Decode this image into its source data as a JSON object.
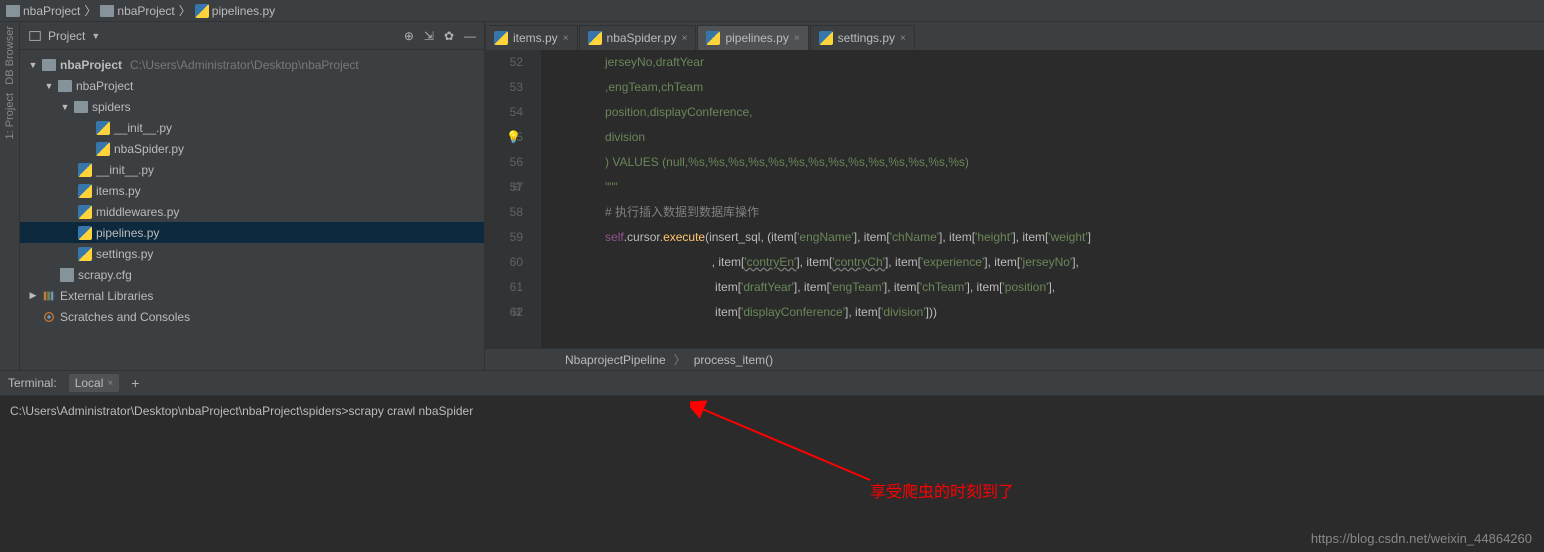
{
  "breadcrumb": {
    "root": "nbaProject",
    "folder": "nbaProject",
    "file": "pipelines.py"
  },
  "panel": {
    "title": "Project"
  },
  "tree": {
    "root": {
      "name": "nbaProject",
      "path": "C:\\Users\\Administrator\\Desktop\\nbaProject"
    },
    "pkg": "nbaProject",
    "spiders": "spiders",
    "init": "__init__.py",
    "nbaSpider": "nbaSpider.py",
    "init2": "__init__.py",
    "items": "items.py",
    "middlewares": "middlewares.py",
    "pipelines": "pipelines.py",
    "settings": "settings.py",
    "scrapycfg": "scrapy.cfg",
    "ext": "External Libraries",
    "scratches": "Scratches and Consoles"
  },
  "tabs": [
    {
      "label": "items.py"
    },
    {
      "label": "nbaSpider.py"
    },
    {
      "label": "pipelines.py"
    },
    {
      "label": "settings.py"
    }
  ],
  "code": {
    "lines": [
      "52",
      "53",
      "54",
      "55",
      "56",
      "57",
      "58",
      "59",
      "60",
      "61",
      "62"
    ],
    "l52a": "jerseyNo",
    "l52b": "draftYear",
    "l53a": "engTeam",
    "l53b": "chTeam",
    "l54a": "position",
    "l54b": "displayConference",
    "l55a": "division",
    "l56a": ") VALUES (null,%s,%s,%s,%s,%s,%s,%s,%s,%s,%s,%s,%s,%s,%s)",
    "l56b": "\"\"\"",
    "l58": "# 执行插入数据到数据库操作",
    "l59self": "self",
    "l59fn": "execute",
    "l59args": "(insert_sql, (item[",
    "l59f1": "'engName'",
    "l59f2": "'chName'",
    "l59f3": "'height'",
    "l59f4": "'weight'",
    "l60sep": ", item[",
    "l60a": "'contryEn'",
    "l60b": "'contryCh'",
    "l60c": "'experience'",
    "l60d": "'jerseyNo'",
    "l61a": "'draftYear'",
    "l61b": "'engTeam'",
    "l61c": "'chTeam'",
    "l61d": "'position'",
    "l62a": "'displayConference'",
    "l62b": "'division'"
  },
  "crumb2": {
    "cls": "NbaprojectPipeline",
    "fn": "process_item()"
  },
  "terminal": {
    "label": "Terminal:",
    "tab": "Local",
    "prompt": "C:\\Users\\Administrator\\Desktop\\nbaProject\\nbaProject\\spiders>",
    "cmd": "scrapy crawl nbaSpider"
  },
  "annotation": "享受爬虫的时刻到了",
  "watermark": "https://blog.csdn.net/weixin_44864260"
}
